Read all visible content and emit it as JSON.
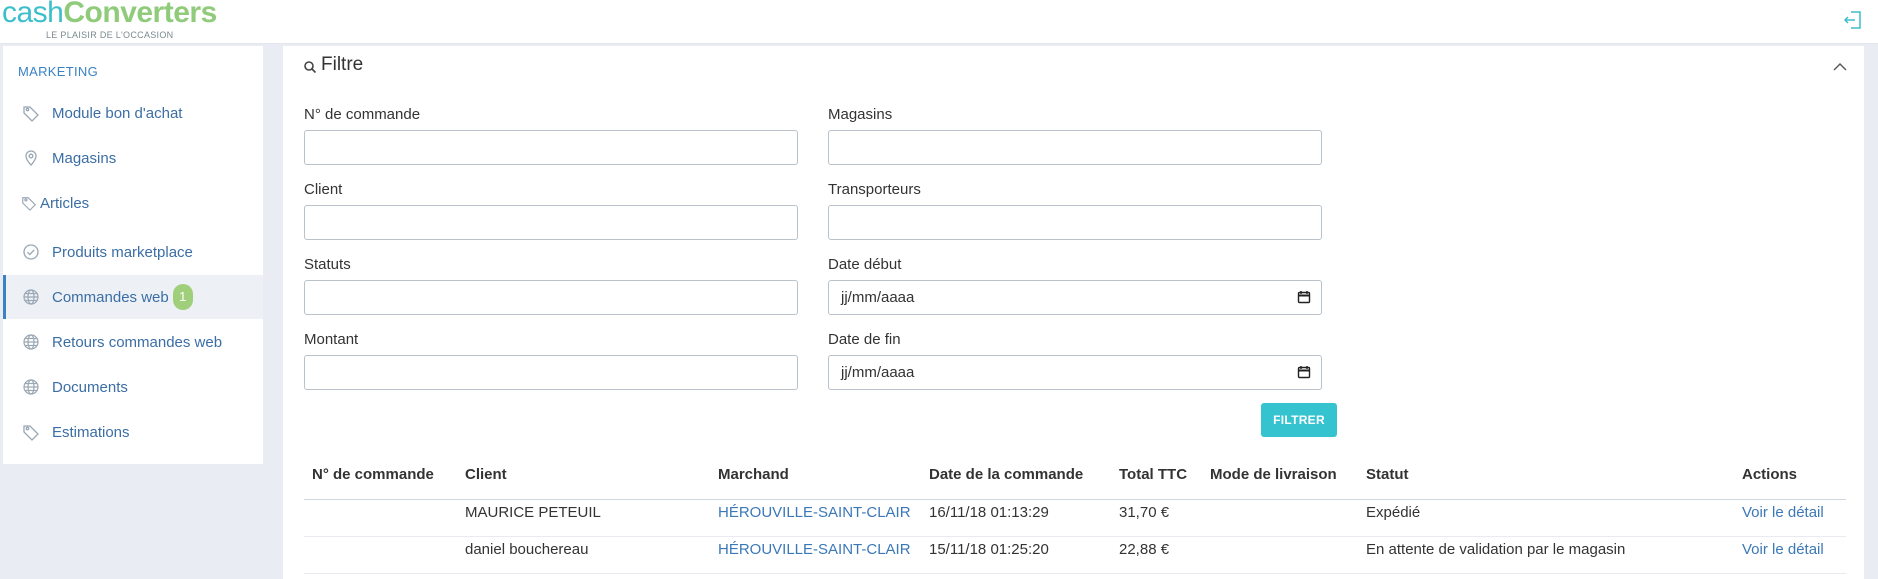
{
  "header": {
    "logo_part1": "cash",
    "logo_part2": "Converters",
    "logo_tagline": "LE PLAISIR DE L'OCCASION",
    "logout_icon": "logout-icon"
  },
  "sidebar": {
    "section_label": "MARKETING",
    "items": [
      {
        "label": "Module bon d'achat",
        "icon": "tag-icon"
      },
      {
        "label": "Magasins",
        "icon": "map-pin-icon"
      },
      {
        "label": "Articles",
        "icon": "tag-icon"
      },
      {
        "label": "Produits marketplace",
        "icon": "check-circle-icon"
      },
      {
        "label": "Commandes web",
        "icon": "globe-icon",
        "badge": "1",
        "active": true
      },
      {
        "label": "Retours commandes web",
        "icon": "globe-icon"
      },
      {
        "label": "Documents",
        "icon": "globe-icon"
      },
      {
        "label": "Estimations",
        "icon": "tag-icon"
      }
    ]
  },
  "filter": {
    "title": "Filtre",
    "fields": {
      "order_number": {
        "label": "N° de commande",
        "value": ""
      },
      "stores": {
        "label": "Magasins",
        "value": ""
      },
      "client": {
        "label": "Client",
        "value": ""
      },
      "carriers": {
        "label": "Transporteurs",
        "value": ""
      },
      "statuses": {
        "label": "Statuts",
        "value": ""
      },
      "start_date": {
        "label": "Date début",
        "placeholder": "jj/mm/aaaa"
      },
      "amount": {
        "label": "Montant",
        "value": ""
      },
      "end_date": {
        "label": "Date de fin",
        "placeholder": "jj/mm/aaaa"
      }
    },
    "submit_label": "FILTRER"
  },
  "table": {
    "columns": [
      "N° de commande",
      "Client",
      "Marchand",
      "Date de la commande",
      "Total TTC",
      "Mode de livraison",
      "Statut",
      "Actions"
    ],
    "rows": [
      {
        "order": "",
        "client": "MAURICE PETEUIL",
        "merchant": "HÉROUVILLE-SAINT-CLAIR",
        "date": "16/11/18 01:13:29",
        "total": "31,70 €",
        "delivery": "",
        "status": "Expédié",
        "action": "Voir le détail"
      },
      {
        "order": "",
        "client": "daniel bouchereau",
        "merchant": "HÉROUVILLE-SAINT-CLAIR",
        "date": "15/11/18 01:25:20",
        "total": "22,88 €",
        "delivery": "",
        "status": "En attente de validation par le magasin",
        "action": "Voir le détail"
      }
    ]
  },
  "colors": {
    "accent": "#35c3cf",
    "link": "#3b78b8",
    "badge": "#9fcf7a",
    "logo_green": "#8fcb7a"
  }
}
